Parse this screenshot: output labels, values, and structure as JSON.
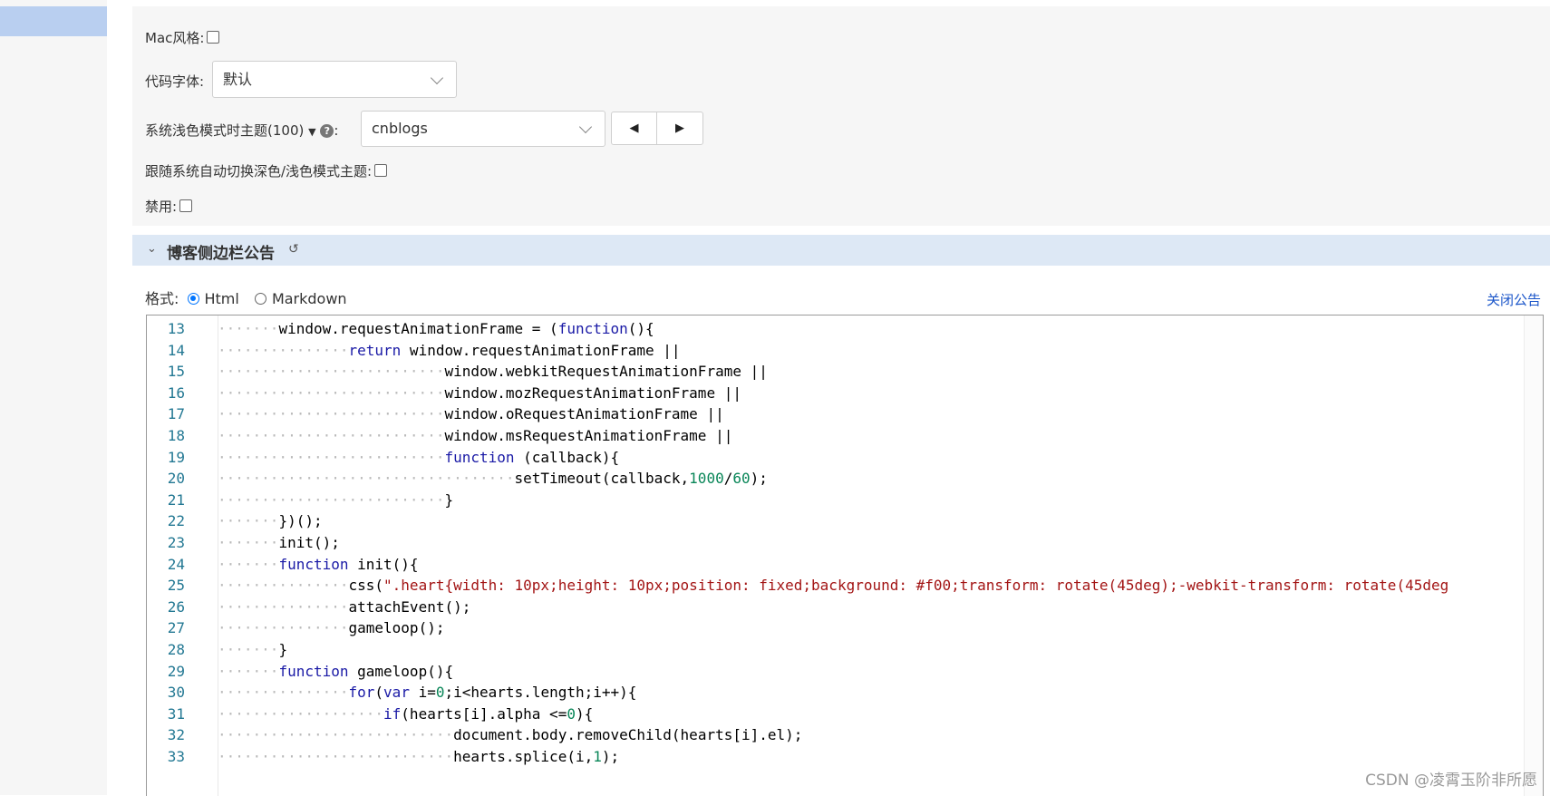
{
  "settings": {
    "mac_style_label": "Mac风格:",
    "code_font_label": "代码字体:",
    "code_font_value": "默认",
    "light_theme_label": "系统浅色模式时主题(100)",
    "light_theme_colon": ":",
    "light_theme_value": "cnblogs",
    "prev_btn": "◀",
    "next_btn": "▶",
    "auto_switch_label": "跟随系统自动切换深色/浅色模式主题:",
    "disable_label": "禁用:",
    "help_glyph": "?"
  },
  "section": {
    "title": "博客侧边栏公告",
    "format_label": "格式:",
    "option_html": "Html",
    "option_markdown": "Markdown",
    "selected_format": "Html",
    "close_link": "关闭公告"
  },
  "editor": {
    "lines": [
      {
        "n": "13",
        "dots": "·······",
        "segs": [
          [
            "p",
            "window.requestAnimationFrame = ("
          ],
          [
            "k",
            "function"
          ],
          [
            "p",
            "(){"
          ]
        ]
      },
      {
        "n": "14",
        "dots": "···············",
        "segs": [
          [
            "k",
            "return"
          ],
          [
            "p",
            " window.requestAnimationFrame ||"
          ]
        ]
      },
      {
        "n": "15",
        "dots": "··························",
        "segs": [
          [
            "p",
            "window.webkitRequestAnimationFrame ||"
          ]
        ]
      },
      {
        "n": "16",
        "dots": "··························",
        "segs": [
          [
            "p",
            "window.mozRequestAnimationFrame ||"
          ]
        ]
      },
      {
        "n": "17",
        "dots": "··························",
        "segs": [
          [
            "p",
            "window.oRequestAnimationFrame ||"
          ]
        ]
      },
      {
        "n": "18",
        "dots": "··························",
        "segs": [
          [
            "p",
            "window.msRequestAnimationFrame ||"
          ]
        ]
      },
      {
        "n": "19",
        "dots": "··························",
        "segs": [
          [
            "k",
            "function"
          ],
          [
            "p",
            " (callback){"
          ]
        ]
      },
      {
        "n": "20",
        "dots": "··································",
        "segs": [
          [
            "p",
            "setTimeout(callback,"
          ],
          [
            "n",
            "1000"
          ],
          [
            "p",
            "/"
          ],
          [
            "n",
            "60"
          ],
          [
            "p",
            ");"
          ]
        ]
      },
      {
        "n": "21",
        "dots": "··························",
        "segs": [
          [
            "p",
            "}"
          ]
        ]
      },
      {
        "n": "22",
        "dots": "·······",
        "segs": [
          [
            "p",
            "})();"
          ]
        ]
      },
      {
        "n": "23",
        "dots": "·······",
        "segs": [
          [
            "p",
            "init();"
          ]
        ]
      },
      {
        "n": "24",
        "dots": "·······",
        "segs": [
          [
            "k",
            "function"
          ],
          [
            "p",
            " init(){"
          ]
        ]
      },
      {
        "n": "25",
        "dots": "···············",
        "segs": [
          [
            "p",
            "css("
          ],
          [
            "s",
            "\".heart{width: 10px;height: 10px;position: fixed;background: #f00;transform: rotate(45deg);-webkit-transform: rotate(45deg"
          ]
        ]
      },
      {
        "n": "26",
        "dots": "···············",
        "segs": [
          [
            "p",
            "attachEvent();"
          ]
        ]
      },
      {
        "n": "27",
        "dots": "···············",
        "segs": [
          [
            "p",
            "gameloop();"
          ]
        ]
      },
      {
        "n": "28",
        "dots": "·······",
        "segs": [
          [
            "p",
            "}"
          ]
        ]
      },
      {
        "n": "29",
        "dots": "·······",
        "segs": [
          [
            "k",
            "function"
          ],
          [
            "p",
            " gameloop(){"
          ]
        ]
      },
      {
        "n": "30",
        "dots": "···············",
        "segs": [
          [
            "k",
            "for"
          ],
          [
            "p",
            "("
          ],
          [
            "k",
            "var"
          ],
          [
            "p",
            " i="
          ],
          [
            "n",
            "0"
          ],
          [
            "p",
            ";i<hearts.length;i++){"
          ]
        ]
      },
      {
        "n": "31",
        "dots": "···················",
        "segs": [
          [
            "k",
            "if"
          ],
          [
            "p",
            "(hearts[i].alpha <="
          ],
          [
            "n",
            "0"
          ],
          [
            "p",
            "){"
          ]
        ]
      },
      {
        "n": "32",
        "dots": "···························",
        "segs": [
          [
            "p",
            "document.body.removeChild(hearts[i].el);"
          ]
        ]
      },
      {
        "n": "33",
        "dots": "···························",
        "segs": [
          [
            "p",
            "hearts.splice(i,"
          ],
          [
            "n",
            "1"
          ],
          [
            "p",
            ");"
          ]
        ]
      }
    ]
  },
  "watermark": "CSDN @凌霄玉阶非所愿"
}
